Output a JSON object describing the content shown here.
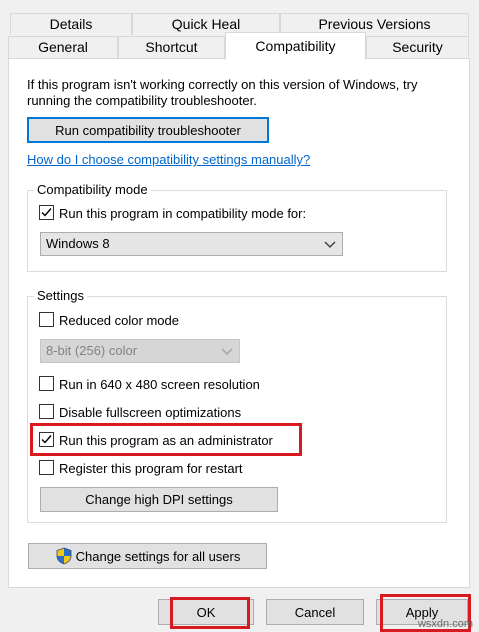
{
  "tabs_row1": [
    {
      "label": "Details"
    },
    {
      "label": "Quick Heal"
    },
    {
      "label": "Previous Versions"
    }
  ],
  "tabs_row2": [
    {
      "label": "General"
    },
    {
      "label": "Shortcut"
    },
    {
      "label": "Compatibility",
      "active": true
    },
    {
      "label": "Security"
    }
  ],
  "intro": {
    "line1": "If this program isn't working correctly on this version of Windows, try",
    "line2": "running the compatibility troubleshooter."
  },
  "troubleshooter_button": "Run compatibility troubleshooter",
  "help_link": "How do I choose compatibility settings manually?",
  "compat_mode": {
    "label": "Compatibility mode",
    "checkbox_label": "Run this program in compatibility mode for:",
    "checked": true,
    "selected_os": "Windows 8"
  },
  "settings": {
    "label": "Settings",
    "reduced_color": {
      "label": "Reduced color mode",
      "checked": false
    },
    "color_select": "8-bit (256) color",
    "res640": {
      "label": "Run in 640 x 480 screen resolution",
      "checked": false
    },
    "fullscreen": {
      "label": "Disable fullscreen optimizations",
      "checked": false
    },
    "admin": {
      "label": "Run this program as an administrator",
      "checked": true
    },
    "restart": {
      "label": "Register this program for restart",
      "checked": false
    },
    "dpi_button": "Change high DPI settings"
  },
  "all_users_button": "Change settings for all users",
  "footer": {
    "ok": "OK",
    "cancel": "Cancel",
    "apply": "Apply"
  },
  "watermark": "wsxdn.com",
  "colors": {
    "highlight": "#d8191f",
    "link": "#0066cc",
    "focus": "#0078d7"
  }
}
